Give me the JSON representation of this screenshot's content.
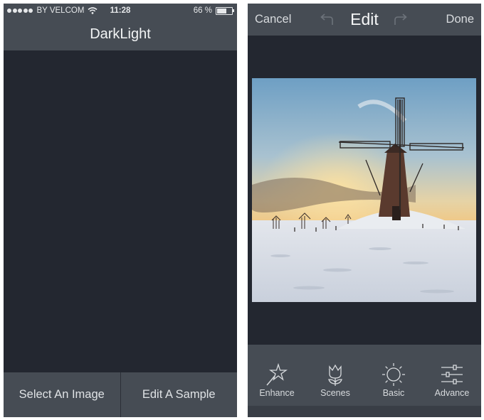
{
  "left_screen": {
    "status": {
      "carrier": "BY VELCOM",
      "time": "11:28",
      "battery_text": "66 %",
      "battery_level": 0.66
    },
    "app_title": "DarkLight",
    "buttons": {
      "select_image": "Select An Image",
      "edit_sample": "Edit A Sample"
    }
  },
  "right_screen": {
    "header": {
      "cancel": "Cancel",
      "title": "Edit",
      "done": "Done"
    },
    "tools": [
      {
        "label": "Enhance",
        "icon": "magic-wand-star-icon"
      },
      {
        "label": "Scenes",
        "icon": "tulip-flower-icon"
      },
      {
        "label": "Basic",
        "icon": "sun-icon"
      },
      {
        "label": "Advance",
        "icon": "sliders-icon"
      }
    ],
    "photo_subject": "windmill-in-snow-photo"
  },
  "colors": {
    "background": "#232730",
    "bar": "#464c54",
    "text": "#e9ecef"
  }
}
